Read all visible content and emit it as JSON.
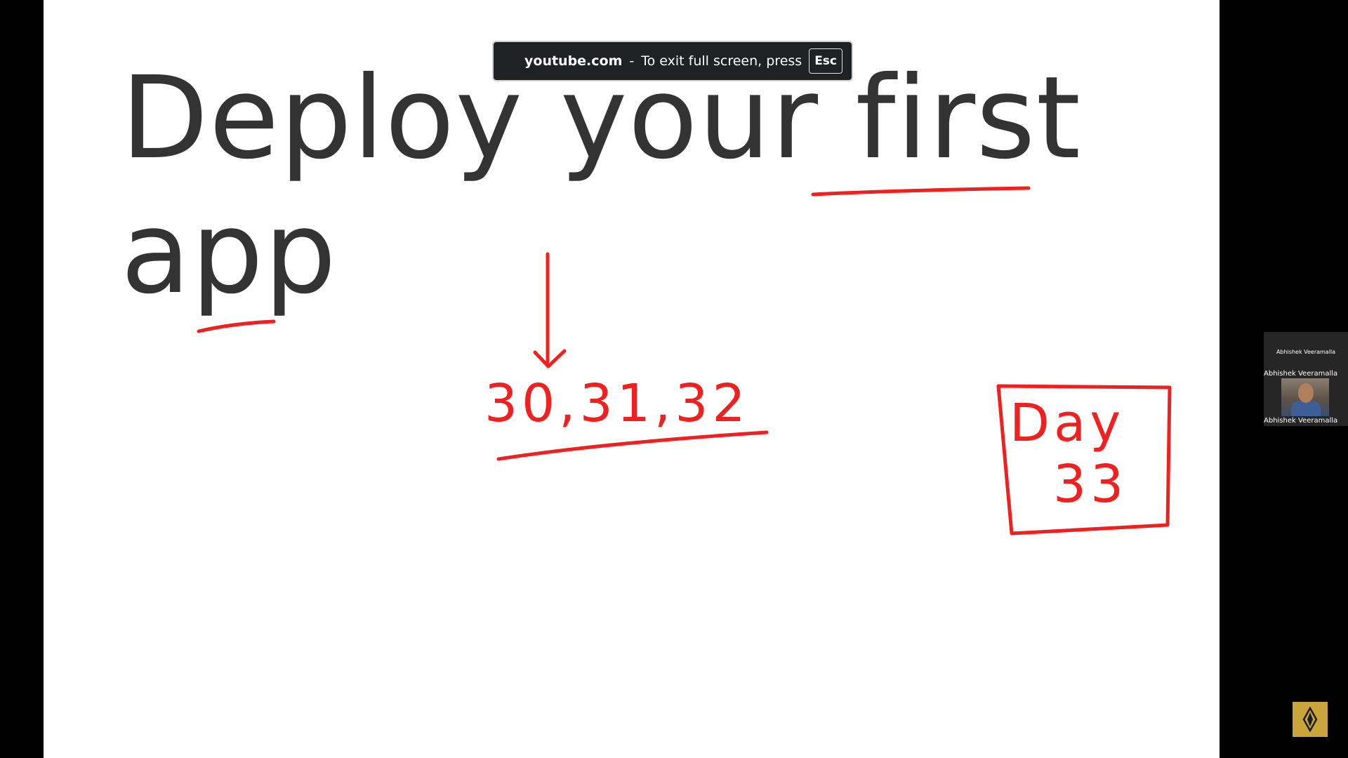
{
  "slide": {
    "title_line_1": "Deploy your first",
    "title_line_2": "app"
  },
  "annotations": {
    "days_list": "30,31,32",
    "day_label": "Day",
    "day_number": "33",
    "ink_color": "#ef2020"
  },
  "fullscreen_notice": {
    "domain": "youtube.com",
    "separator": "-",
    "message": "To exit full screen, press",
    "key": "Esc"
  },
  "video_tile": {
    "top_name": "Abhishek Veeramalla",
    "name": "Abhishek Veeramalla",
    "bottom_name": "Abhishek Veeramalla"
  },
  "corner_logo": {
    "icon": "diamond-logo-icon"
  }
}
